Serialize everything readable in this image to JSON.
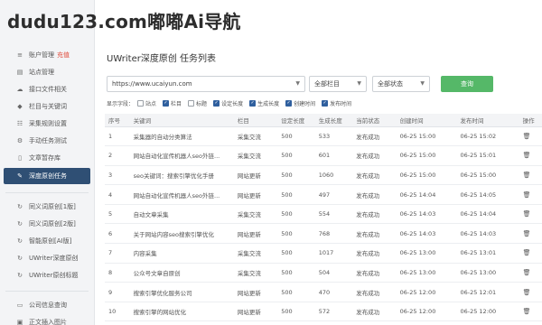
{
  "watermark": "dudu123.com嘟嘟Ai导航",
  "sidebar": {
    "items": [
      {
        "label": "账户管理",
        "tag": "充值",
        "icon": "list-icon"
      },
      {
        "label": "站点管理",
        "icon": "site-icon"
      },
      {
        "label": "接口文件相关",
        "icon": "cloud-icon"
      },
      {
        "label": "栏目与关键词",
        "icon": "tag-icon"
      },
      {
        "label": "采集规则设置",
        "icon": "sliders-icon"
      },
      {
        "label": "手动任务测试",
        "icon": "gear-icon"
      },
      {
        "label": "文章暂存库",
        "icon": "file-icon"
      },
      {
        "label": "深度原创任务",
        "icon": "edit-icon",
        "active": true
      }
    ],
    "items2": [
      {
        "label": "同义词原创[1版]",
        "icon": "refresh-icon"
      },
      {
        "label": "同义词原创[2版]",
        "icon": "refresh-icon"
      },
      {
        "label": "智能原创[AI版]",
        "icon": "refresh-icon"
      },
      {
        "label": "UWriter深度原创",
        "icon": "refresh-icon"
      },
      {
        "label": "UWriter原创标题",
        "icon": "refresh-icon"
      }
    ],
    "items3": [
      {
        "label": "公司信息查询",
        "icon": "monitor-icon"
      },
      {
        "label": "正文插入图片",
        "icon": "image-icon"
      }
    ]
  },
  "page": {
    "title": "UWriter深度原创 任务列表"
  },
  "filters": {
    "url_value": "https://www.ucaiyun.com",
    "column_select": "全部栏目",
    "status_select": "全部状态",
    "search_label": "查询"
  },
  "display_options": {
    "label": "显示字段：",
    "options": [
      {
        "label": "站点",
        "checked": false
      },
      {
        "label": "栏目",
        "checked": true
      },
      {
        "label": "标题",
        "checked": false
      },
      {
        "label": "设定长度",
        "checked": true
      },
      {
        "label": "生成长度",
        "checked": true
      },
      {
        "label": "创建时间",
        "checked": true
      },
      {
        "label": "发布时间",
        "checked": true
      }
    ]
  },
  "table": {
    "headers": [
      "序号",
      "关键词",
      "栏目",
      "设定长度",
      "生成长度",
      "当前状态",
      "创建时间",
      "发布时间",
      "操作"
    ],
    "rows": [
      [
        "1",
        "采集器的自动分类算法",
        "采集交流",
        "500",
        "533",
        "发布成功",
        "06-25 15:00",
        "06-25 15:02"
      ],
      [
        "2",
        "网站自动化宣传机器人seo外链...",
        "采集交流",
        "500",
        "601",
        "发布成功",
        "06-25 15:00",
        "06-25 15:01"
      ],
      [
        "3",
        "seo关键词：搜索引擎优化手册",
        "网站更新",
        "500",
        "1060",
        "发布成功",
        "06-25 15:00",
        "06-25 15:00"
      ],
      [
        "4",
        "网站自动化宣传机器人seo外链...",
        "网站更新",
        "500",
        "497",
        "发布成功",
        "06-25 14:04",
        "06-25 14:05"
      ],
      [
        "5",
        "自动文章采集",
        "采集交流",
        "500",
        "554",
        "发布成功",
        "06-25 14:03",
        "06-25 14:04"
      ],
      [
        "6",
        "关于网站内容seo搜索引擎优化",
        "网站更新",
        "500",
        "768",
        "发布成功",
        "06-25 14:03",
        "06-25 14:03"
      ],
      [
        "7",
        "内容采集",
        "采集交流",
        "500",
        "1017",
        "发布成功",
        "06-25 13:00",
        "06-25 13:01"
      ],
      [
        "8",
        "公众号文章自原创",
        "采集交流",
        "500",
        "504",
        "发布成功",
        "06-25 13:00",
        "06-25 13:00"
      ],
      [
        "9",
        "搜索引擎优化服务公司",
        "网站更新",
        "500",
        "470",
        "发布成功",
        "06-25 12:00",
        "06-25 12:01"
      ],
      [
        "10",
        "搜索引擎的网站优化",
        "网站更新",
        "500",
        "572",
        "发布成功",
        "06-25 12:00",
        "06-25 12:00"
      ]
    ],
    "row_action_icon": "trash-icon",
    "delete_glyph": "🗑"
  }
}
